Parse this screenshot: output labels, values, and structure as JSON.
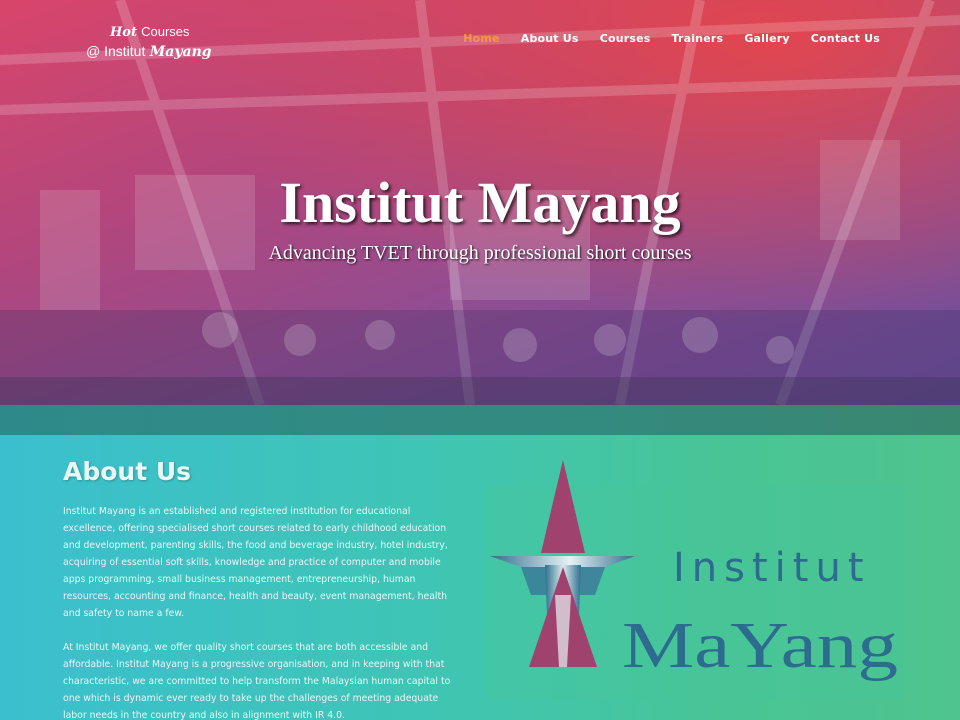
{
  "logo": {
    "hot": "Hot",
    "courses": "Courses",
    "at": "@ Institut",
    "mayang": "Mayang"
  },
  "nav": {
    "items": [
      {
        "label": "Home",
        "active": true
      },
      {
        "label": "About Us",
        "active": false
      },
      {
        "label": "Courses",
        "active": false
      },
      {
        "label": "Trainers",
        "active": false
      },
      {
        "label": "Gallery",
        "active": false
      },
      {
        "label": "Contact Us",
        "active": false
      }
    ]
  },
  "hero": {
    "title": "Institut Mayang",
    "subtitle": "Advancing TVET through professional short courses"
  },
  "about": {
    "title": "About Us",
    "paragraphs": [
      "Institut Mayang is an established and registered institution for educational excellence, offering specialised short courses related to early childhood education and development, parenting skills, the food and beverage industry, hotel industry, acquiring of essential soft skills, knowledge and practice of computer and mobile apps programming, small business management, entrepreneurship, human resources, accounting and finance, health and beauty, event management, health and safety to name a few.",
      "At Institut Mayang, we offer quality short courses that are both accessible and affordable. Institut Mayang is a progressive organisation, and in keeping with that characteristic, we are committed to help transform the Malaysian human capital to one which is dynamic ever ready to take up the challenges of meeting adequate labor needs in the country and also in alignment with IR 4.0."
    ]
  },
  "brand": {
    "word1": "Institut",
    "word2": "MaYang"
  },
  "colors": {
    "nav_active": "#f59a37",
    "logo_magenta": "#a0426e",
    "logo_blue": "#2d6b8f"
  }
}
